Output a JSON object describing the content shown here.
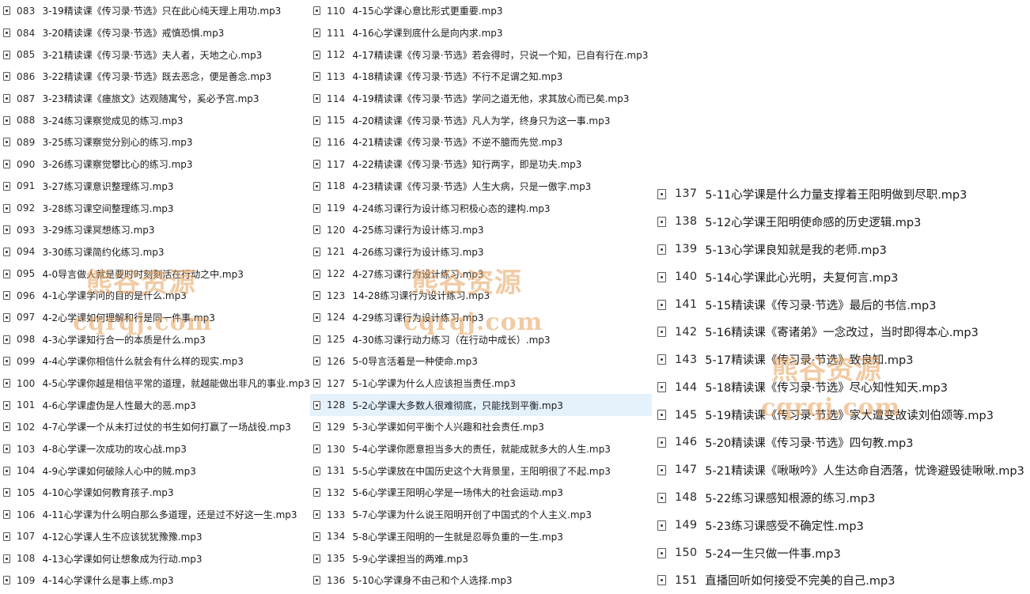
{
  "columns": [
    {
      "items": [
        {
          "num": "083",
          "name": "3-19精读课《传习录·节选》只在此心纯天理上用功.mp3"
        },
        {
          "num": "084",
          "name": "3-20精读课《传习录·节选》戒慎恐惧.mp3"
        },
        {
          "num": "085",
          "name": "3-21精读课《传习录·节选》夫人者，天地之心.mp3"
        },
        {
          "num": "086",
          "name": "3-22精读课《传习录·节选》既去恶念，便是善念.mp3"
        },
        {
          "num": "087",
          "name": "3-23精读课《瘗旅文》达观随寓兮，奚必予宫.mp3"
        },
        {
          "num": "088",
          "name": "3-24练习课察觉成见的练习.mp3"
        },
        {
          "num": "089",
          "name": "3-25练习课察觉分别心的练习.mp3"
        },
        {
          "num": "090",
          "name": "3-26练习课察觉攀比心的练习.mp3"
        },
        {
          "num": "091",
          "name": "3-27练习课意识整理练习.mp3"
        },
        {
          "num": "092",
          "name": "3-28练习课空间整理练习.mp3"
        },
        {
          "num": "093",
          "name": "3-29练习课冥想练习.mp3"
        },
        {
          "num": "094",
          "name": "3-30练习课简约化练习.mp3"
        },
        {
          "num": "095",
          "name": "4-0导言做人就是要时时刻刻活在行动之中.mp3"
        },
        {
          "num": "096",
          "name": "4-1心学课学问的目的是什么.mp3"
        },
        {
          "num": "097",
          "name": "4-2心学课如何理解和行是同一件事.mp3"
        },
        {
          "num": "098",
          "name": "4-3心学课知行合一的本质是什么.mp3"
        },
        {
          "num": "099",
          "name": "4-4心学课你相信什么就会有什么样的现实.mp3"
        },
        {
          "num": "100",
          "name": "4-5心学课你越是相信平常的道理，就越能做出非凡的事业.mp3"
        },
        {
          "num": "101",
          "name": "4-6心学课虚伪是人性最大的恶.mp3"
        },
        {
          "num": "102",
          "name": "4-7心学课一个从未打过仗的书生如何打赢了一场战役.mp3"
        },
        {
          "num": "103",
          "name": "4-8心学课一次成功的攻心战.mp3"
        },
        {
          "num": "104",
          "name": "4-9心学课如何破除人心中的贼.mp3"
        },
        {
          "num": "105",
          "name": "4-10心学课如何教育孩子.mp3"
        },
        {
          "num": "106",
          "name": "4-11心学课为什么明白那么多道理，还是过不好这一生.mp3"
        },
        {
          "num": "107",
          "name": "4-12心学课人生不应该犹犹豫豫.mp3"
        },
        {
          "num": "108",
          "name": "4-13心学课如何让想象成为行动.mp3"
        },
        {
          "num": "109",
          "name": "4-14心学课什么是事上练.mp3"
        }
      ]
    },
    {
      "items": [
        {
          "num": "110",
          "name": "4-15心学课心意比形式更重要.mp3"
        },
        {
          "num": "111",
          "name": "4-16心学课到底什么是向内求.mp3"
        },
        {
          "num": "112",
          "name": "4-17精读课《传习录·节选》若会得时，只说一个知，已自有行在.mp3"
        },
        {
          "num": "113",
          "name": "4-18精读课《传习录·节选》不行不足谓之知.mp3"
        },
        {
          "num": "114",
          "name": "4-19精读课《传习录·节选》学问之道无他，求其放心而已矣.mp3"
        },
        {
          "num": "115",
          "name": "4-20精读课《传习录·节选》凡人为学，终身只为这一事.mp3"
        },
        {
          "num": "116",
          "name": "4-21精读课《传习录·节选》不逆不臆而先觉.mp3"
        },
        {
          "num": "117",
          "name": "4-22精读课《传习录·节选》知行两字，即是功夫.mp3"
        },
        {
          "num": "118",
          "name": "4-23精读课《传习录·节选》人生大病，只是一傲字.mp3"
        },
        {
          "num": "119",
          "name": "4-24练习课行为设计练习积极心态的建构.mp3"
        },
        {
          "num": "120",
          "name": "4-25练习课行为设计练习.mp3"
        },
        {
          "num": "121",
          "name": "4-26练习课行为设计练习.mp3"
        },
        {
          "num": "122",
          "name": "4-27练习课行为设计练习.mp3"
        },
        {
          "num": "123",
          "name": "14-28练习课行为设计练习.mp3"
        },
        {
          "num": "124",
          "name": "4-29练习课行为设计练习.mp3"
        },
        {
          "num": "125",
          "name": "4-30练习课行动力练习（在行动中成长）.mp3"
        },
        {
          "num": "126",
          "name": "5-0导言活着是一种使命.mp3"
        },
        {
          "num": "127",
          "name": "5-1心学课为什么人应该担当责任.mp3"
        },
        {
          "num": "128",
          "name": "5-2心学课大多数人很难彻底，只能找到平衡.mp3"
        },
        {
          "num": "129",
          "name": "5-3心学课如何平衡个人兴趣和社会责任.mp3"
        },
        {
          "num": "130",
          "name": "5-4心学课你愿意担当多大的责任，就能成就多大的人生.mp3"
        },
        {
          "num": "131",
          "name": "5-5心学课放在中国历史这个大背景里，王阳明很了不起.mp3"
        },
        {
          "num": "132",
          "name": "5-6心学课王阳明心学是一场伟大的社会运动.mp3"
        },
        {
          "num": "133",
          "name": "5-7心学课为什么说王阳明开创了中国式的个人主义.mp3"
        },
        {
          "num": "134",
          "name": "5-8心学课王阳明的一生就是忍辱负重的一生.mp3"
        },
        {
          "num": "135",
          "name": "5-9心学课担当的两难.mp3"
        },
        {
          "num": "136",
          "name": "5-10心学课身不由己和个人选择.mp3"
        }
      ]
    },
    {
      "items": [
        {
          "num": "137",
          "name": "5-11心学课是什么力量支撑着王阳明做到尽职.mp3"
        },
        {
          "num": "138",
          "name": "5-12心学课王阳明使命感的历史逻辑.mp3"
        },
        {
          "num": "139",
          "name": "5-13心学课良知就是我的老师.mp3"
        },
        {
          "num": "140",
          "name": "5-14心学课此心光明，夫复何言.mp3"
        },
        {
          "num": "141",
          "name": "5-15精读课《传习录·节选》最后的书信.mp3"
        },
        {
          "num": "142",
          "name": "5-16精读课《寄诸弟》一念改过，当时即得本心.mp3"
        },
        {
          "num": "143",
          "name": "5-17精读课《传习录·节选》致良知.mp3"
        },
        {
          "num": "144",
          "name": "5-18精读课《传习录·节选》尽心知性知天.mp3"
        },
        {
          "num": "145",
          "name": "5-19精读课《传习录·节选》家大遭变故读刘伯颂等.mp3"
        },
        {
          "num": "146",
          "name": "5-20精读课《传习录·节选》四句教.mp3"
        },
        {
          "num": "147",
          "name": "5-21精读课《啾啾吟》人生达命自洒落，忧谗避毁徒啾啾.mp3"
        },
        {
          "num": "148",
          "name": "5-22练习课感知根源的练习.mp3"
        },
        {
          "num": "149",
          "name": "5-23练习课感受不确定性.mp3"
        },
        {
          "num": "150",
          "name": "5-24一生只做一件事.mp3"
        },
        {
          "num": "151",
          "name": "直播回听如何接受不完美的自己.mp3"
        }
      ]
    }
  ],
  "selected_index": {
    "column": 1,
    "item": 18
  },
  "watermarks": [
    {
      "cn": "熊谷资源",
      "en": "cqrqj.com"
    },
    {
      "cn": "熊谷资源",
      "en": "cqrqj.com"
    },
    {
      "cn": "熊谷资源",
      "en": "cqrqj.com"
    }
  ],
  "colors": {
    "selection": "#e5f1fb",
    "watermark": "#e7a15a"
  },
  "icons": {
    "file": "audio-file-icon"
  }
}
